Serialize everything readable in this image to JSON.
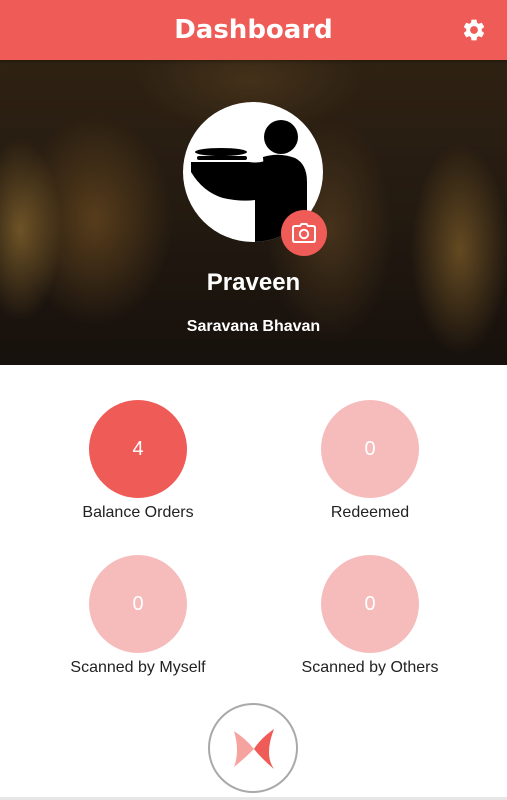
{
  "header": {
    "title": "Dashboard",
    "settings_icon": "gear-icon",
    "background_color": "#ef5b57"
  },
  "profile": {
    "name": "Praveen",
    "store": "Saravana Bhavan",
    "avatar_icon": "waiter-icon",
    "camera_icon": "camera-icon"
  },
  "stats": [
    {
      "label": "Balance Orders",
      "value": "4",
      "color": "#ef5b57"
    },
    {
      "label": "Redeemed",
      "value": "0",
      "color": "#f6bcbb"
    },
    {
      "label": "Scanned by Myself",
      "value": "0",
      "color": "#f6bcbb"
    },
    {
      "label": "Scanned by Others",
      "value": "0",
      "color": "#f6bcbb"
    }
  ],
  "fab": {
    "icon": "x-logo-icon"
  }
}
